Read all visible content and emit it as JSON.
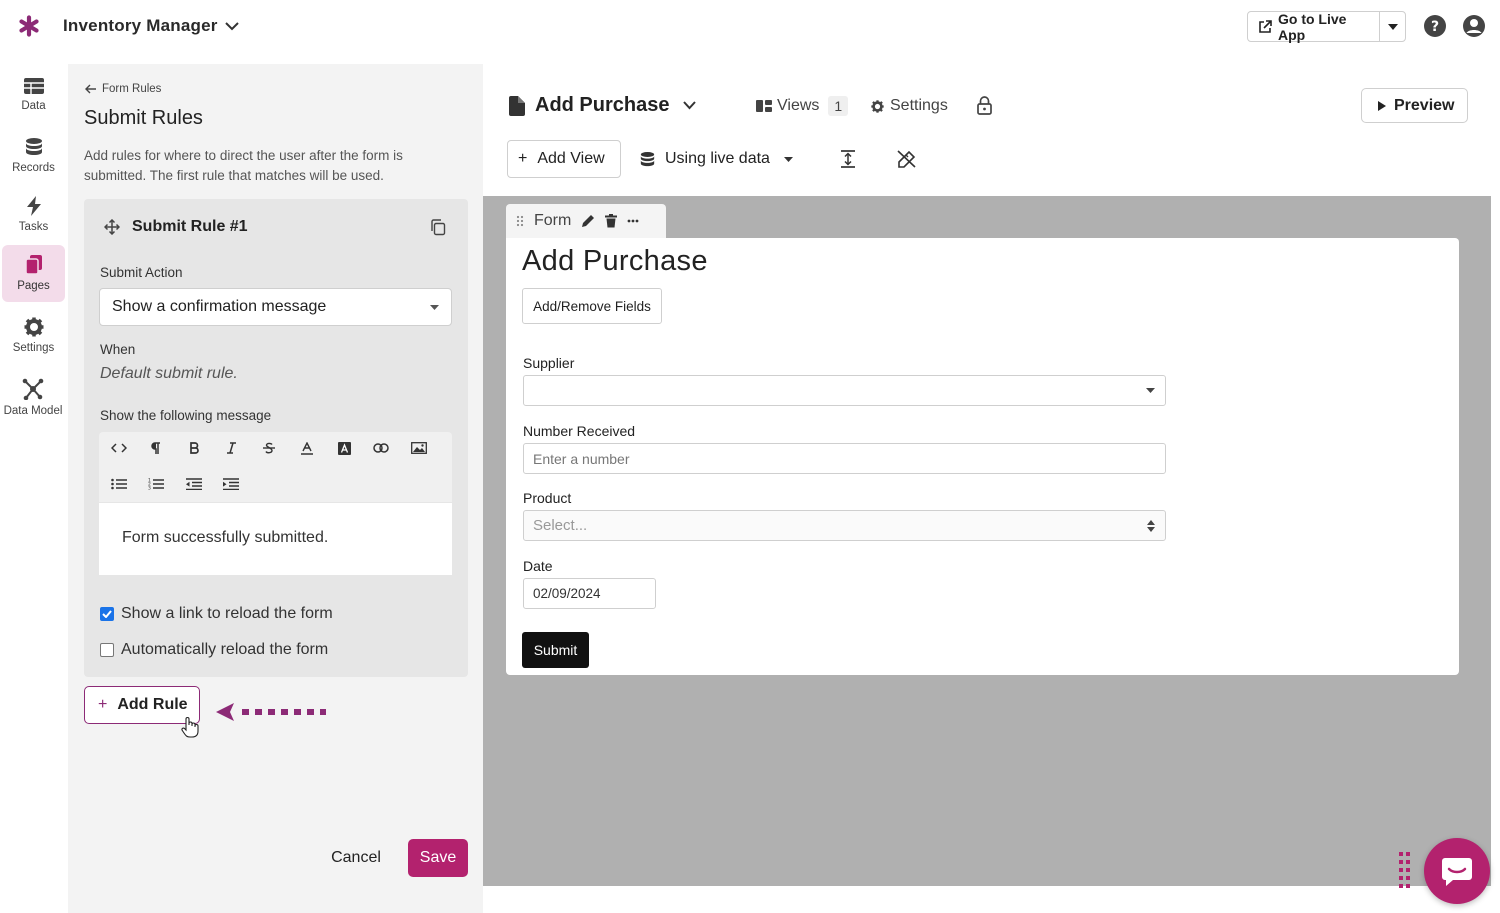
{
  "topbar": {
    "app_title": "Inventory Manager",
    "live_app_label": "Go to Live App"
  },
  "nav": {
    "items": [
      {
        "label": "Data",
        "icon": "table-icon"
      },
      {
        "label": "Records",
        "icon": "database-icon"
      },
      {
        "label": "Tasks",
        "icon": "bolt-icon"
      },
      {
        "label": "Pages",
        "icon": "pages-icon",
        "active": true
      },
      {
        "label": "Settings",
        "icon": "gear-icon"
      },
      {
        "label": "Data Model",
        "icon": "data-model-icon"
      }
    ]
  },
  "panel": {
    "back_label": "Form Rules",
    "title": "Submit Rules",
    "description": "Add rules for where to direct the user after the form is submitted. The first rule that matches will be used.",
    "rule": {
      "title": "Submit Rule #1",
      "submit_action_label": "Submit Action",
      "submit_action_value": "Show a confirmation message",
      "when_label": "When",
      "when_value": "Default submit rule.",
      "message_label": "Show the following message",
      "message_text": "Form successfully submitted.",
      "checkbox_reload_link": {
        "label": "Show a link to reload the form",
        "checked": true
      },
      "checkbox_auto_reload": {
        "label": "Automatically reload the form",
        "checked": false
      }
    },
    "add_rule_label": "Add Rule",
    "cancel_label": "Cancel",
    "save_label": "Save"
  },
  "main": {
    "page_title": "Add Purchase",
    "views_label": "Views",
    "views_count": "1",
    "settings_label": "Settings",
    "preview_label": "Preview",
    "add_view_label": "Add View",
    "data_source_label": "Using live data",
    "form_tab_label": "Form",
    "form": {
      "title": "Add Purchase",
      "add_remove_label": "Add/Remove Fields",
      "fields": [
        {
          "label": "Supplier",
          "value": "",
          "placeholder": ""
        },
        {
          "label": "Number Received",
          "value": "",
          "placeholder": "Enter a number"
        },
        {
          "label": "Product",
          "value": "",
          "placeholder": "Select..."
        },
        {
          "label": "Date",
          "value": "02/09/2024",
          "placeholder": ""
        }
      ],
      "submit_label": "Submit"
    }
  },
  "colors": {
    "accent": "#b3226e",
    "nav_active_bg": "#f3dcea",
    "canvas_bg": "#b0b0b0",
    "arrow": "#8c2a76"
  }
}
